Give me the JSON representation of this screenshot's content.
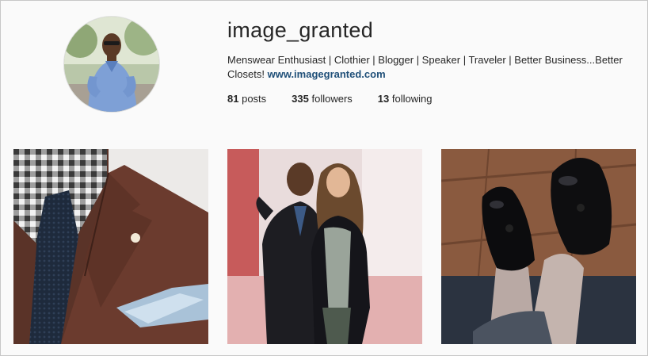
{
  "profile": {
    "username": "image_granted",
    "bio_text": "Menswear Enthusiast | Clothier | Blogger | Speaker | Traveler | Better Business...Better Closets!",
    "bio_link": "www.imagegranted.com",
    "stats": {
      "posts_count": "81",
      "posts_label": "posts",
      "followers_count": "335",
      "followers_label": "followers",
      "following_count": "13",
      "following_label": "following"
    }
  },
  "posts": [
    {
      "subject": "brown-jacket-pocket-square-photo"
    },
    {
      "subject": "couple-at-party-photo"
    },
    {
      "subject": "black-tassel-loafers-photo"
    }
  ],
  "colors": {
    "link": "#1f4f78",
    "text": "#262626",
    "background": "#fafafa"
  }
}
